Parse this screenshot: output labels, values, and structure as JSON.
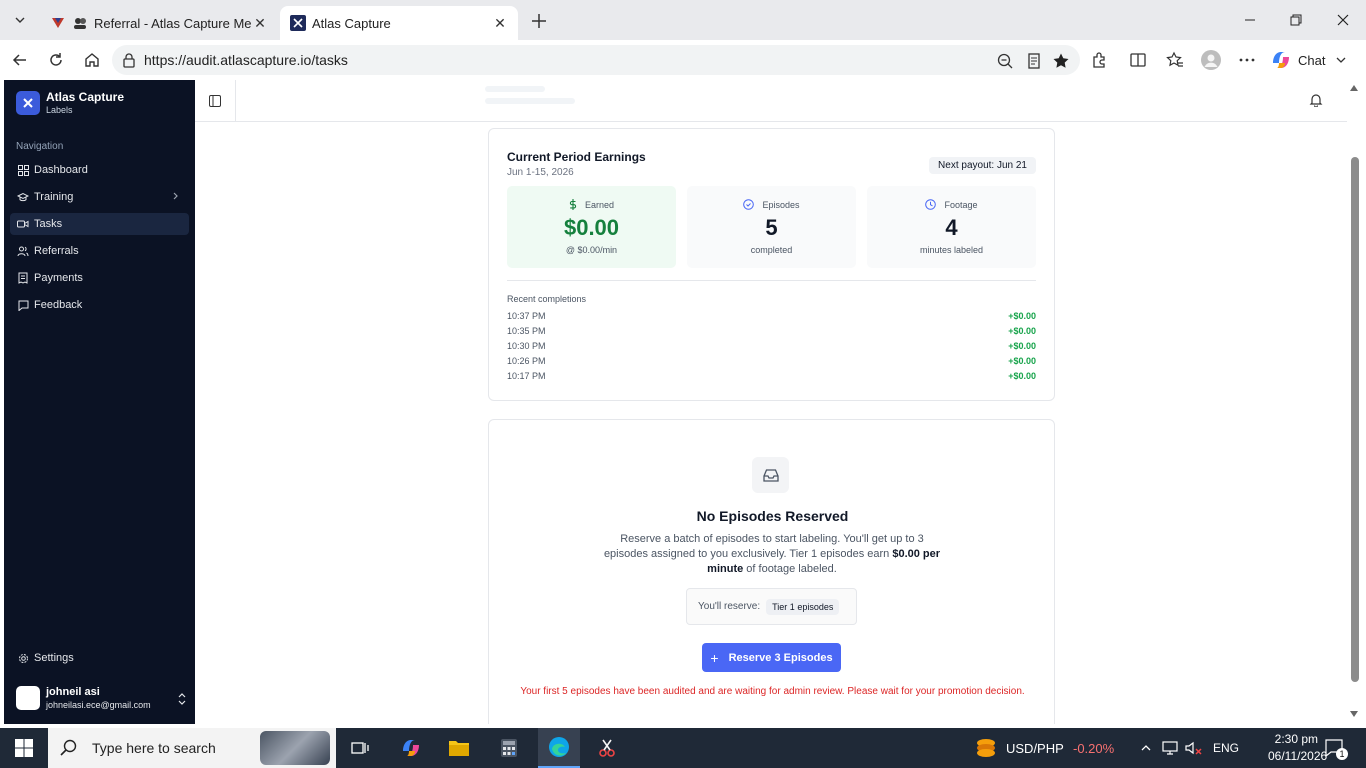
{
  "browser": {
    "tabs": [
      {
        "title": "Referral - Atlas Capture Memb",
        "active": false
      },
      {
        "title": "Atlas Capture",
        "active": true
      }
    ],
    "url": "https://audit.atlascapture.io/tasks",
    "chat_label": "Chat"
  },
  "sidebar": {
    "brand_name": "Atlas Capture",
    "brand_sub": "Labels",
    "nav_heading": "Navigation",
    "items": [
      {
        "label": "Dashboard",
        "icon": "grid-icon"
      },
      {
        "label": "Training",
        "icon": "graduation-cap-icon"
      },
      {
        "label": "Tasks",
        "icon": "video-icon",
        "active": true
      },
      {
        "label": "Referrals",
        "icon": "users-icon"
      },
      {
        "label": "Payments",
        "icon": "receipt-icon"
      },
      {
        "label": "Feedback",
        "icon": "message-icon"
      }
    ],
    "settings_label": "Settings",
    "user": {
      "name": "johneil asi",
      "email": "johneilasi.ece@gmail.com"
    }
  },
  "earnings": {
    "title": "Current Period Earnings",
    "period": "Jun 1-15, 2026",
    "payout_badge": "Next payout: Jun 21",
    "stats": {
      "earned": {
        "label": "Earned",
        "value": "$0.00",
        "sub": "@ $0.00/min"
      },
      "episodes": {
        "label": "Episodes",
        "value": "5",
        "sub": "completed"
      },
      "footage": {
        "label": "Footage",
        "value": "4",
        "sub": "minutes labeled"
      }
    },
    "recent_title": "Recent completions",
    "recent": [
      {
        "time": "10:37 PM",
        "amount": "+$0.00"
      },
      {
        "time": "10:35 PM",
        "amount": "+$0.00"
      },
      {
        "time": "10:30 PM",
        "amount": "+$0.00"
      },
      {
        "time": "10:26 PM",
        "amount": "+$0.00"
      },
      {
        "time": "10:17 PM",
        "amount": "+$0.00"
      }
    ]
  },
  "empty_state": {
    "title": "No Episodes Reserved",
    "desc_part1": "Reserve a batch of episodes to start labeling. You'll get up to 3 episodes assigned to you exclusively. Tier 1 episodes earn ",
    "desc_bold": "$0.00 per minute",
    "desc_part2": " of footage labeled.",
    "reserve_label": "You'll reserve:",
    "tier_badge": "Tier 1 episodes",
    "button": "Reserve 3 Episodes",
    "audit_note": "Your first 5 episodes have been audited and are waiting for admin review. Please wait for your promotion decision."
  },
  "taskbar": {
    "search_placeholder": "Type here to search",
    "currency_pair": "USD/PHP",
    "currency_change": "-0.20%",
    "language": "ENG",
    "time": "2:30 pm",
    "date": "06/11/2026",
    "notification_count": "1"
  },
  "colors": {
    "sidebar_bg": "#0b1224",
    "accent": "#4a67f5",
    "earned_green": "#15803d",
    "alert_red": "#dc2626"
  }
}
